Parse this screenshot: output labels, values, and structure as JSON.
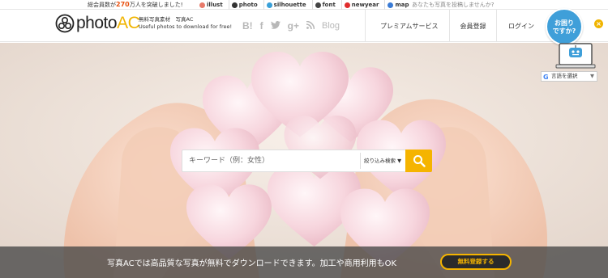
{
  "topbar": {
    "members_prefix": "総会員数が",
    "members_count": "270",
    "members_suffix": "万人を突破しました!",
    "sites": [
      {
        "label": "illust",
        "color": "#e87a6a"
      },
      {
        "label": "photo",
        "color": "#333333"
      },
      {
        "label": "silhouette",
        "color": "#3aa0d8"
      },
      {
        "label": "font",
        "color": "#444444"
      },
      {
        "label": "newyear",
        "color": "#e02c2c"
      },
      {
        "label": "map",
        "color": "#3a7bd5"
      }
    ],
    "post_link": "あなたも写真を投稿しませんか?"
  },
  "header": {
    "logo_text_1": "photo",
    "logo_text_2": "AC",
    "tagline_1": "無料写真素材　写真AC",
    "tagline_2": "Useful photos to download for free!",
    "social": [
      "B!",
      "f",
      "𝕥",
      "g+",
      "Blog"
    ],
    "nav": {
      "premium": "プレミアムサービス",
      "signup": "会員登録",
      "login": "ログイン"
    }
  },
  "help": {
    "line1": "お困り",
    "line2": "ですか?",
    "close": "×"
  },
  "translate": {
    "label": "言語を選択",
    "arrow": "▼"
  },
  "search": {
    "placeholder": "キーワード（例：女性）",
    "filter_label": "絞り込み検索 ▼"
  },
  "banner": {
    "message": "写真ACでは高品質な写真が無料でダウンロードできます。加工や商用利用もOK",
    "cta": "無料登録する"
  },
  "colors": {
    "accent": "#f5b400",
    "help_blue": "#3f9fd9"
  }
}
